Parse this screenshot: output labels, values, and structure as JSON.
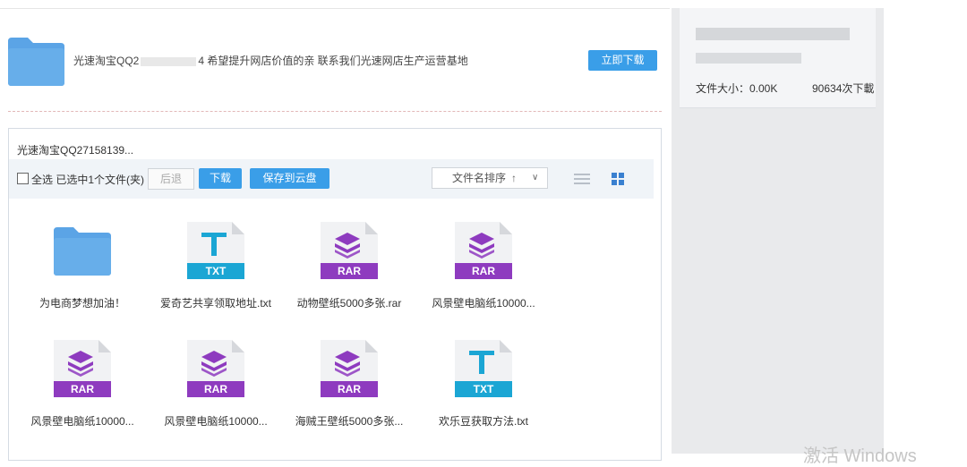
{
  "header": {
    "text_prefix": "光速淘宝QQ2",
    "text_suffix": "4 希望提升网店价值的亲 联系我们光速网店生产运营基地",
    "download_button": "立即下载"
  },
  "panel": {
    "title": "光速淘宝QQ27158139...",
    "toolbar": {
      "select_all_label": "全选",
      "selected_info": "已选中1个文件(夹)",
      "back_button": "后退",
      "download_button": "下载",
      "save_to_cloud_button": "保存到云盘",
      "sort_label": "文件名排序",
      "sort_arrow": "↑",
      "sort_chevron": "∨"
    },
    "files": [
      {
        "name": "为电商梦想加油！",
        "type": "folder"
      },
      {
        "name": "爱奇艺共享领取地址.txt",
        "type": "txt",
        "badge": "TXT"
      },
      {
        "name": "动物壁纸5000多张.rar",
        "type": "rar",
        "badge": "RAR"
      },
      {
        "name": "风景壁电脑纸10000...",
        "type": "rar",
        "badge": "RAR"
      },
      {
        "name": "风景壁电脑纸10000...",
        "type": "rar",
        "badge": "RAR"
      },
      {
        "name": "风景壁电脑纸10000...",
        "type": "rar",
        "badge": "RAR"
      },
      {
        "name": "海贼王壁纸5000多张...",
        "type": "rar",
        "badge": "RAR"
      },
      {
        "name": "欢乐豆获取方法.txt",
        "type": "txt",
        "badge": "TXT"
      }
    ]
  },
  "sidebar": {
    "file_size": "文件大小：0.00K",
    "download_count": "90634次下載"
  },
  "watermark": "激活 Windows",
  "colors": {
    "accent": "#3a9ee8",
    "folder": "#5ba4e6",
    "rar": "#8e3bbf",
    "txt": "#1ba6d4"
  }
}
